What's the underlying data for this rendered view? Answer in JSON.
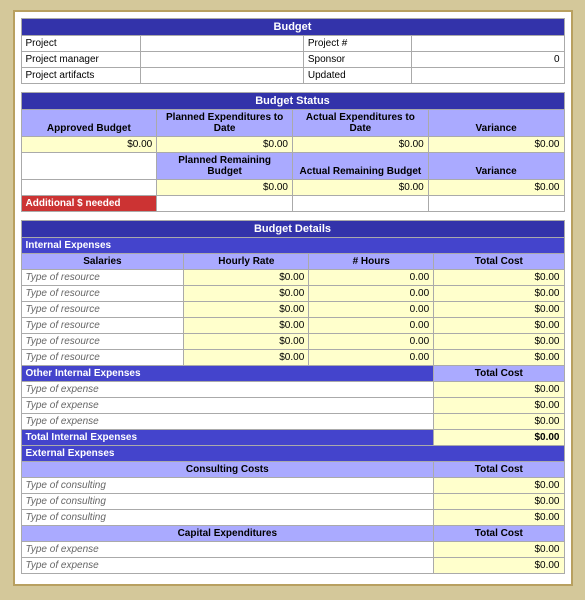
{
  "title": "Budget",
  "project_section": {
    "rows": [
      {
        "label": "Project",
        "right_label": "Project #",
        "value": ""
      },
      {
        "label": "Project manager",
        "right_label": "Sponsor",
        "value": "0"
      },
      {
        "label": "Project artifacts",
        "right_label": "Updated",
        "value": ""
      }
    ]
  },
  "budget_status": {
    "title": "Budget Status",
    "col1": "Approved Budget",
    "col2": "Planned Expenditures to Date",
    "col3": "Actual Expenditures to Date",
    "col4": "Variance",
    "row1": [
      "$0.00",
      "$0.00",
      "$0.00",
      "$0.00"
    ],
    "col2b": "Planned Remaining Budget",
    "col3b": "Actual Remaining Budget",
    "col4b": "Variance",
    "row2": [
      "$0.00",
      "$0.00",
      "$0.00"
    ],
    "additional_label": "Additional $ needed"
  },
  "budget_details": {
    "title": "Budget Details",
    "internal_label": "Internal Expenses",
    "salaries_label": "Salaries",
    "hourly_rate_label": "Hourly Rate",
    "hours_label": "# Hours",
    "total_cost_label": "Total Cost",
    "resource_placeholder": "Type of resource",
    "salary_rows": [
      {
        "resource": "Type of resource",
        "rate": "$0.00",
        "hours": "0.00",
        "cost": "$0.00"
      },
      {
        "resource": "Type of resource",
        "rate": "$0.00",
        "hours": "0.00",
        "cost": "$0.00"
      },
      {
        "resource": "Type of resource",
        "rate": "$0.00",
        "hours": "0.00",
        "cost": "$0.00"
      },
      {
        "resource": "Type of resource",
        "rate": "$0.00",
        "hours": "0.00",
        "cost": "$0.00"
      },
      {
        "resource": "Type of resource",
        "rate": "$0.00",
        "hours": "0.00",
        "cost": "$0.00"
      },
      {
        "resource": "Type of resource",
        "rate": "$0.00",
        "hours": "0.00",
        "cost": "$0.00"
      }
    ],
    "other_internal_label": "Other Internal Expenses",
    "expense_placeholder": "Type of expense",
    "other_rows": [
      {
        "expense": "Type of expense",
        "cost": "$0.00"
      },
      {
        "expense": "Type of expense",
        "cost": "$0.00"
      },
      {
        "expense": "Type of expense",
        "cost": "$0.00"
      }
    ],
    "total_internal_label": "Total Internal Expenses",
    "total_internal_value": "$0.00",
    "external_label": "External Expenses",
    "consulting_label": "Consulting Costs",
    "consulting_rows": [
      {
        "type": "Type of consulting",
        "cost": "$0.00"
      },
      {
        "type": "Type of consulting",
        "cost": "$0.00"
      },
      {
        "type": "Type of consulting",
        "cost": "$0.00"
      }
    ],
    "capital_label": "Capital Expenditures",
    "capital_rows": [
      {
        "type": "Type of expense",
        "cost": "$0.00"
      },
      {
        "type": "Type of expense",
        "cost": "$0.00"
      }
    ]
  }
}
